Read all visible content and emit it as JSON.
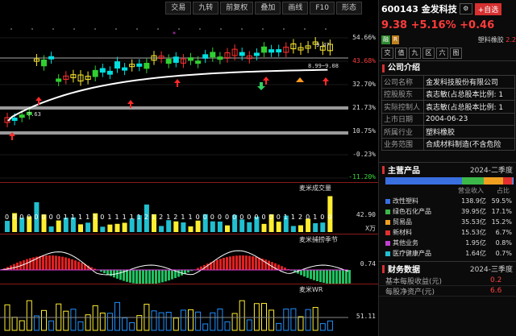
{
  "toolbar": [
    "交易",
    "九转",
    "前复权",
    "叠加",
    "画线",
    "F10",
    "形态"
  ],
  "main_chart": {
    "axis_labels": [
      "54.66%",
      "43.68%",
      "32.70%",
      "21.73%",
      "10.75%",
      "-0.23%",
      "-11.20%"
    ],
    "high_label": "9.47",
    "low_label": "7.63",
    "range_label": "8.99~9.08"
  },
  "volume_panel": {
    "title": "麦米成交量",
    "axis_value": "42.90",
    "unit": "X万",
    "digits": "0000000011111011111212121100000000000011201002"
  },
  "season_panel": {
    "title": "麦米捕捞季节",
    "axis_value": "0.74"
  },
  "wr_panel": {
    "title": "麦米WR",
    "axis_value": "51.11"
  },
  "stock": {
    "code_name": "600143 金发科技",
    "price": "9.38",
    "change_pct": "+5.16%",
    "change": "+0.46",
    "add_button": "+自选",
    "tags": [
      "融",
      "R"
    ],
    "sector_name": "塑料橡胶",
    "sector_value": "2.2"
  },
  "quick_buttons": [
    "交",
    "值",
    "九",
    "区",
    "六",
    "图"
  ],
  "company": {
    "title": "公司介绍",
    "rows": [
      {
        "k": "公司名称",
        "v": "金发科技股份有限公司"
      },
      {
        "k": "控股股东",
        "v": "袁志敏(占总股本比例: 1"
      },
      {
        "k": "实际控制人",
        "v": "袁志敏(占总股本比例: 1"
      },
      {
        "k": "上市日期",
        "v": "2004-06-23"
      },
      {
        "k": "所属行业",
        "v": "塑料橡胶"
      },
      {
        "k": "业务范围",
        "v": "合成材料制造(不含危险"
      }
    ]
  },
  "products": {
    "title": "主营产品",
    "period": "2024-二季度",
    "col_headers": [
      "",
      "营业收入",
      "占比"
    ],
    "rows": [
      {
        "name": "改性塑料",
        "revenue": "138.9亿",
        "pct": "59.5%",
        "color": "#3a6fe0"
      },
      {
        "name": "绿色石化产品",
        "revenue": "39.95亿",
        "pct": "17.1%",
        "color": "#3cb84a"
      },
      {
        "name": "贸易品",
        "revenue": "35.53亿",
        "pct": "15.2%",
        "color": "#f0a020"
      },
      {
        "name": "新材料",
        "revenue": "15.53亿",
        "pct": "6.7%",
        "color": "#e03030"
      },
      {
        "name": "其他业务",
        "revenue": "1.95亿",
        "pct": "0.8%",
        "color": "#c040d0"
      },
      {
        "name": "医疗健康产品",
        "revenue": "1.64亿",
        "pct": "0.7%",
        "color": "#20c0d0"
      }
    ]
  },
  "finance": {
    "title": "财务数据",
    "period": "2024-三季度",
    "rows": [
      {
        "k": "基本每股收益(元)",
        "v": "0.2"
      },
      {
        "k": "每股净资产(元)",
        "v": "6.6"
      }
    ]
  }
}
